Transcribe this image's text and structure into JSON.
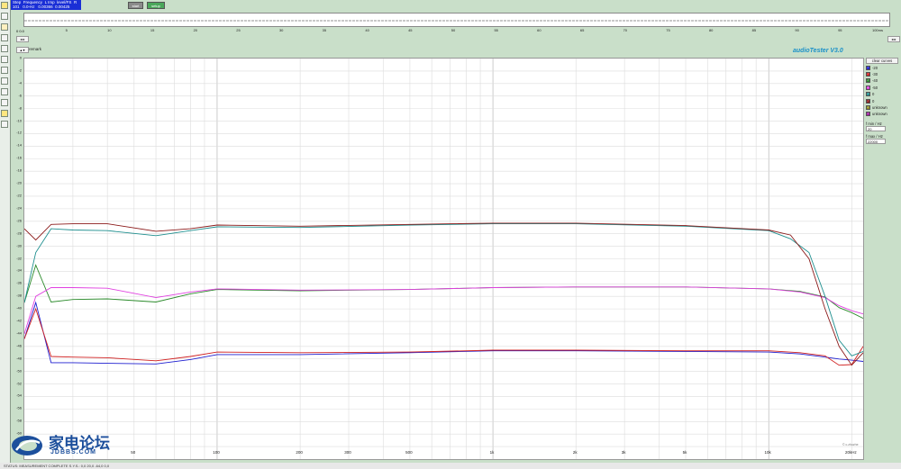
{
  "readout": {
    "headers": [
      "Step",
      "Frequency",
      "L Imp",
      "level/FS",
      "R"
    ],
    "row": [
      "101",
      "0.0",
      "-Hz",
      "0.00366",
      "0.00425"
    ]
  },
  "toolbar": {
    "start_label": "start",
    "setup_label": "setup"
  },
  "top_scale": {
    "ticks": [
      "5",
      "10",
      "15",
      "20",
      "25",
      "30",
      "35",
      "40",
      "45",
      "50",
      "55",
      "60",
      "65",
      "70",
      "75",
      "80",
      "85",
      "90",
      "95",
      "100ms"
    ],
    "pos_label": "0 0.0"
  },
  "remark_label": "remark",
  "brand": "audioTester  V3.0",
  "chart_data": {
    "type": "line",
    "title": "",
    "xlabel": "",
    "ylabel": "",
    "x_scale": "log",
    "xlim": [
      20,
      22000
    ],
    "ylim": [
      -64,
      0
    ],
    "grid": true,
    "x_tick_labels": [
      {
        "v": 20,
        "t": ""
      },
      {
        "v": 50,
        "t": "50"
      },
      {
        "v": 100,
        "t": "100"
      },
      {
        "v": 200,
        "t": "200"
      },
      {
        "v": 300,
        "t": "300"
      },
      {
        "v": 500,
        "t": "500"
      },
      {
        "v": 1000,
        "t": "1k"
      },
      {
        "v": 2000,
        "t": "2k"
      },
      {
        "v": 3000,
        "t": "3k"
      },
      {
        "v": 5000,
        "t": "5k"
      },
      {
        "v": 10000,
        "t": "10k"
      },
      {
        "v": 20000,
        "t": "20kHz"
      }
    ],
    "y_ticks": [
      0,
      -2,
      -4,
      -6,
      -8,
      -10,
      -12,
      -14,
      -16,
      -18,
      -20,
      -22,
      -24,
      -26,
      -28,
      -30,
      -32,
      -34,
      -36,
      -38,
      -40,
      -42,
      -44,
      -46,
      -48,
      -50,
      -52,
      -54,
      -56,
      -58,
      -60,
      -62
    ],
    "series": [
      {
        "name": "-20",
        "color": "#1f1fd0",
        "x": [
          20,
          22,
          25,
          30,
          40,
          60,
          80,
          100,
          200,
          500,
          1000,
          2000,
          5000,
          10000,
          13000,
          16000,
          18000,
          20000,
          22000
        ],
        "y": [
          -44.8,
          -39,
          -48.6,
          -48.6,
          -48.7,
          -48.8,
          -48.1,
          -47.3,
          -47.3,
          -47,
          -46.7,
          -46.7,
          -46.8,
          -46.9,
          -47.2,
          -47.7,
          -48,
          -48.2,
          -48.4
        ]
      },
      {
        "name": "-30",
        "color": "#d02020",
        "x": [
          20,
          22,
          25,
          30,
          40,
          60,
          80,
          100,
          200,
          500,
          1000,
          2000,
          5000,
          10000,
          13000,
          16000,
          18000,
          20000,
          22000
        ],
        "y": [
          -44.8,
          -40,
          -47.6,
          -47.7,
          -47.8,
          -48.3,
          -47.6,
          -46.9,
          -47,
          -46.9,
          -46.6,
          -46.6,
          -46.7,
          -46.7,
          -47,
          -47.5,
          -49,
          -48.9,
          -46
        ]
      },
      {
        "name": "-40",
        "color": "#2a8a2a",
        "x": [
          20,
          22,
          25,
          30,
          40,
          60,
          80,
          100,
          200,
          500,
          1000,
          2000,
          5000,
          10000,
          13000,
          16000,
          18000,
          20000,
          22000
        ],
        "y": [
          -39,
          -33,
          -38.9,
          -38.5,
          -38.4,
          -38.9,
          -37.6,
          -36.9,
          -37.1,
          -36.9,
          -36.6,
          -36.5,
          -36.5,
          -36.8,
          -37.2,
          -38.1,
          -39.8,
          -40.6,
          -41.5
        ]
      },
      {
        "name": "-50",
        "color": "#e040e0",
        "x": [
          20,
          22,
          25,
          30,
          40,
          60,
          80,
          100,
          200,
          500,
          1000,
          2000,
          5000,
          10000,
          13000,
          16000,
          18000,
          20000,
          22000
        ],
        "y": [
          -44,
          -38,
          -36.6,
          -36.6,
          -36.7,
          -38.2,
          -37.3,
          -36.8,
          -37,
          -36.9,
          -36.6,
          -36.5,
          -36.5,
          -36.8,
          -37.3,
          -38.2,
          -39.5,
          -40.3,
          -40.8
        ]
      },
      {
        "name": "0",
        "color": "#1f8f8f",
        "x": [
          20,
          22,
          25,
          30,
          40,
          60,
          80,
          100,
          200,
          500,
          1000,
          2000,
          5000,
          10000,
          12000,
          14000,
          16000,
          18000,
          20000,
          22000
        ],
        "y": [
          -39,
          -31,
          -27.2,
          -27.4,
          -27.5,
          -28.3,
          -27.5,
          -26.9,
          -27,
          -26.6,
          -26.4,
          -26.4,
          -26.8,
          -27.5,
          -28.8,
          -31,
          -38,
          -45,
          -47.5,
          -46.8
        ]
      },
      {
        "name": "0",
        "color": "#8b1a1a",
        "x": [
          20,
          22,
          25,
          30,
          40,
          60,
          80,
          100,
          200,
          500,
          1000,
          2000,
          5000,
          10000,
          12000,
          14000,
          16000,
          18000,
          20000,
          22000
        ],
        "y": [
          -27.2,
          -29,
          -26.5,
          -26.4,
          -26.4,
          -27.6,
          -27.2,
          -26.6,
          -26.8,
          -26.5,
          -26.3,
          -26.3,
          -26.7,
          -27.4,
          -28.2,
          -32,
          -40,
          -46,
          -49,
          -47
        ]
      },
      {
        "name": "unknown",
        "color": "#909020",
        "x": [],
        "y": []
      },
      {
        "name": "unknown",
        "color": "#a020a0",
        "x": [],
        "y": []
      }
    ]
  },
  "legend": {
    "header": "clear curves",
    "fmin_label": "f min / Hz",
    "fmin_value": "20",
    "fmax_label": "f max / Hz",
    "fmax_value": "22000"
  },
  "watermark": {
    "text": "家电论坛",
    "url": "JDBBS.COM"
  },
  "copyright": "© c.zhuzhe",
  "status_text": "STATUS: MEASUREMENT COMPLETE    S.Y.S.: 0,0 20,0 -64,0 0,0"
}
